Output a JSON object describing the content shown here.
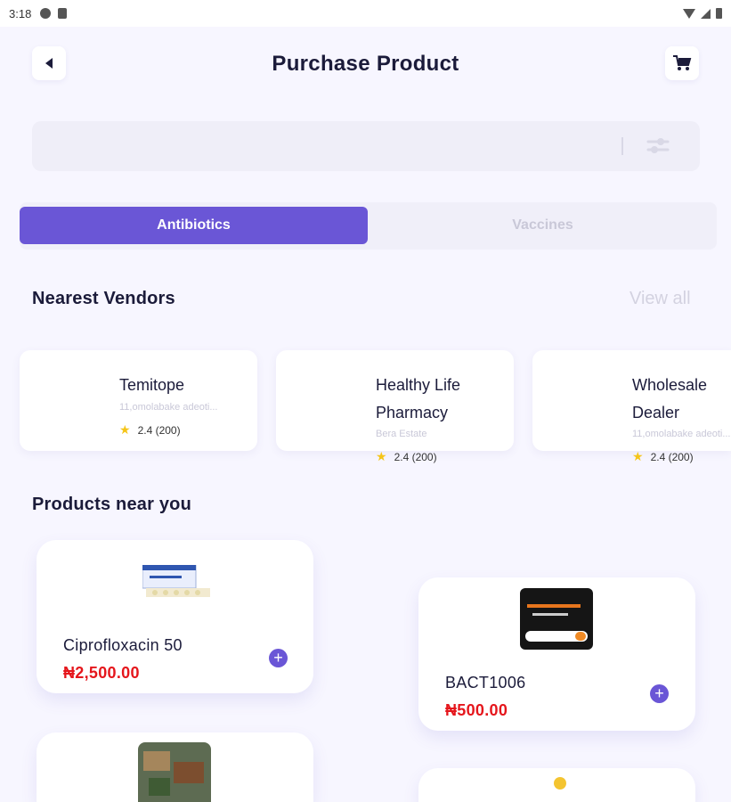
{
  "status_bar": {
    "time": "3:18"
  },
  "header": {
    "title": "Purchase Product",
    "back_icon": "back-arrow-icon",
    "cart_icon": "cart-icon"
  },
  "search": {
    "value": "",
    "placeholder": ""
  },
  "tabs": [
    {
      "label": "Antibiotics",
      "active": true
    },
    {
      "label": "Vaccines",
      "active": false
    }
  ],
  "vendors_section": {
    "title": "Nearest Vendors",
    "view_all": "View all"
  },
  "vendors": [
    {
      "name": "Temitope",
      "address": "11,omolabake adeoti...",
      "rating": "2.4 (200)"
    },
    {
      "name": "Healthy Life Pharmacy",
      "address": "Bera Estate",
      "rating": "2.4 (200)"
    },
    {
      "name": "Wholesale Dealer",
      "address": "11,omolabake adeoti...",
      "rating": "2.4 (200)"
    }
  ],
  "products_section": {
    "title": "Products near you"
  },
  "products": [
    {
      "name": "Ciprofloxacin 50",
      "price": "₦2,500.00"
    },
    {
      "name": "BACT1006",
      "price": "₦500.00"
    }
  ],
  "colors": {
    "accent": "#6a56d6",
    "price": "#e5161c",
    "background": "#f7f6ff"
  }
}
